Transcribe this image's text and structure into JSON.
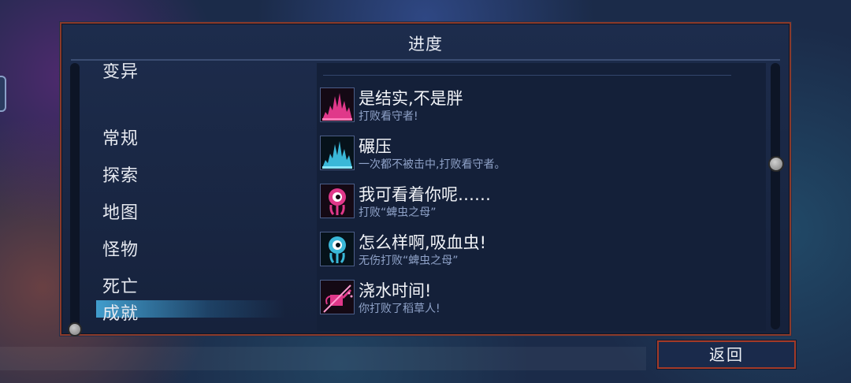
{
  "dialog": {
    "title": "进度"
  },
  "categories": {
    "items": [
      {
        "label": "变异",
        "active": false
      },
      {
        "label": "常规",
        "active": false
      },
      {
        "label": "探索",
        "active": false
      },
      {
        "label": "地图",
        "active": false
      },
      {
        "label": "怪物",
        "active": false
      },
      {
        "label": "死亡",
        "active": false
      },
      {
        "label": "成就",
        "active": true
      }
    ]
  },
  "achievements": {
    "items": [
      {
        "name": "是结实,不是胖",
        "desc": "打败看守者!",
        "icon": "magenta-waveform-icon",
        "color": "#e0388a"
      },
      {
        "name": "碾压",
        "desc": "一次都不被击中,打败看守者。",
        "icon": "cyan-waveform-icon",
        "color": "#3ab8d8"
      },
      {
        "name": "我可看着你呢……",
        "desc": "打败“蜱虫之母”",
        "icon": "magenta-eye-monster-icon",
        "color": "#e0388a"
      },
      {
        "name": "怎么样啊,吸血虫!",
        "desc": "无伤打败“蜱虫之母”",
        "icon": "cyan-eye-monster-icon",
        "color": "#3ab8d8"
      },
      {
        "name": "浇水时间!",
        "desc": "你打败了稻草人!",
        "icon": "magenta-watering-can-icon",
        "color": "#e0388a"
      }
    ]
  },
  "footer": {
    "back_label": "返回"
  }
}
